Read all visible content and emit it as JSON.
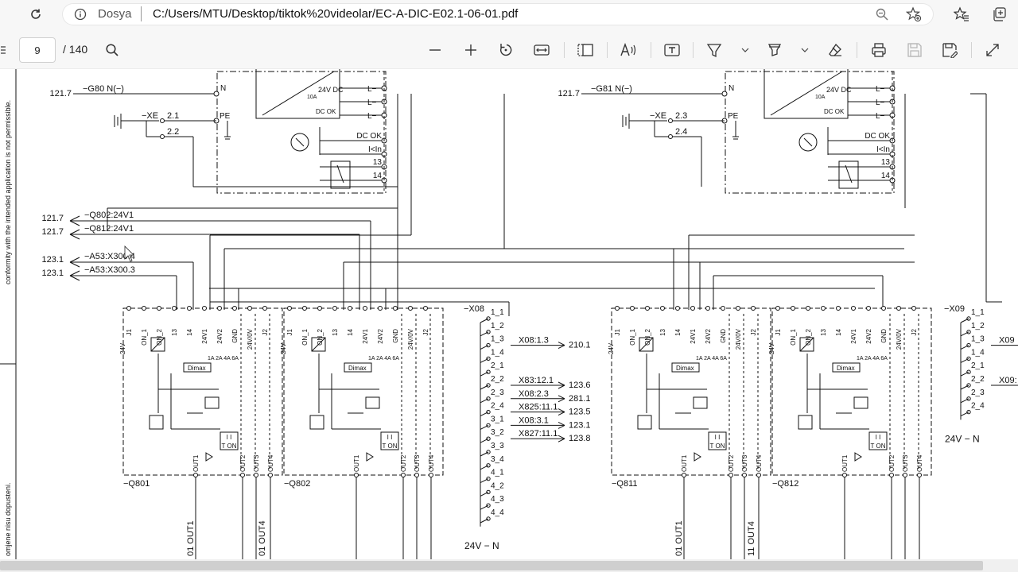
{
  "browser": {
    "site_label": "Dosya",
    "url": "C:/Users/MTU/Desktop/tiktok%20videolar/EC-A-DIC-E02.1-06-01.pdf",
    "icons": [
      "reload-icon",
      "info-icon",
      "zoom-icon",
      "favorite-add-icon",
      "favorites-icon",
      "collections-icon"
    ]
  },
  "pdf_toolbar": {
    "page_current": "9",
    "page_total": "/ 140",
    "icons": [
      "menu-icon",
      "search-icon",
      "zoom-out-icon",
      "zoom-in-icon",
      "rotate-icon",
      "fit-width-icon",
      "page-view-icon",
      "read-aloud-icon",
      "text-box-icon",
      "draw-icon",
      "highlight-icon",
      "eraser-icon",
      "print-icon",
      "save-icon",
      "save-as-icon",
      "fullscreen-icon"
    ]
  },
  "schematic": {
    "margin_text_top": "conformity with the intended application is not permissible.",
    "margin_text_bottom": "omjene nisu dopusteni.",
    "psu": [
      {
        "ref": "121.7",
        "net": "−G80 N(−)",
        "xe": "−XE",
        "pe_a": "2.1",
        "pe_b": "2.2"
      },
      {
        "ref": "121.7",
        "net": "−G81 N(−)",
        "xe": "−XE",
        "pe_a": "2.3",
        "pe_b": "2.4"
      }
    ],
    "psu_labels": {
      "rating": "24V DC",
      "current": "10A",
      "dcok": "DC OK",
      "ilim": "I<In",
      "t13": "13",
      "t14": "14",
      "pe": "PE",
      "n": "N",
      "l": "L−"
    },
    "cross_refs": [
      {
        "ref": "121.7",
        "label": "−Q802:24V1"
      },
      {
        "ref": "121.7",
        "label": "−Q812:24V1"
      },
      {
        "ref": "123.1",
        "label": "−A53:X300.4"
      },
      {
        "ref": "123.1",
        "label": "−A53:X300.3"
      }
    ],
    "modules": [
      "−Q801",
      "−Q802",
      "−Q811",
      "−Q812"
    ],
    "module_pins": [
      "J1",
      "ON_1",
      "ON_2",
      "13",
      "14",
      "24V1",
      "24V2",
      "GND",
      "24V/0V",
      "J2"
    ],
    "module_labels": {
      "current_sel": "1A 2A 4A 6A",
      "dimax": "Dimax",
      "ton": "T ON",
      "out1": "OUT1",
      "out2": "OUT2",
      "out3": "OUT3",
      "out4": "OUT4",
      "v24": "24V"
    },
    "terminal_x08": {
      "name": "−X08",
      "rows": [
        "1_1",
        "1_2",
        "1_3",
        "1_4",
        "2_1",
        "2_2",
        "2_3",
        "2_4",
        "3_1",
        "3_2",
        "3_3",
        "3_4",
        "4_1",
        "4_2",
        "4_3",
        "4_4"
      ],
      "refs": [
        {
          "row": "1_3",
          "label": "X08:1.3",
          "target": "210.1"
        },
        {
          "row": "2_2",
          "label": "X83:12.1",
          "target": "123.6"
        },
        {
          "row": "2_3",
          "label": "X08:2.3",
          "target": "281.1"
        },
        {
          "row": "2_4",
          "label": "X825:11.1",
          "target": "123.5"
        },
        {
          "row": "3_1",
          "label": "X08:3.1",
          "target": "123.1"
        },
        {
          "row": "3_2",
          "label": "X827:11.1",
          "target": "123.8"
        }
      ],
      "footer": "24V − N"
    },
    "terminal_x09": {
      "name": "−X09",
      "rows": [
        "1_1",
        "1_2",
        "1_3",
        "1_4",
        "2_1",
        "2_2",
        "2_3",
        "2_4"
      ],
      "refs": [
        {
          "row": "1_3",
          "label": "X09"
        },
        {
          "row": "2_2",
          "label": "X09:"
        }
      ],
      "footer": "24V − N"
    },
    "bottom_labels": [
      "01 OUT1",
      "01 OUT4",
      "01 OUT1",
      "11 OUT4"
    ]
  }
}
